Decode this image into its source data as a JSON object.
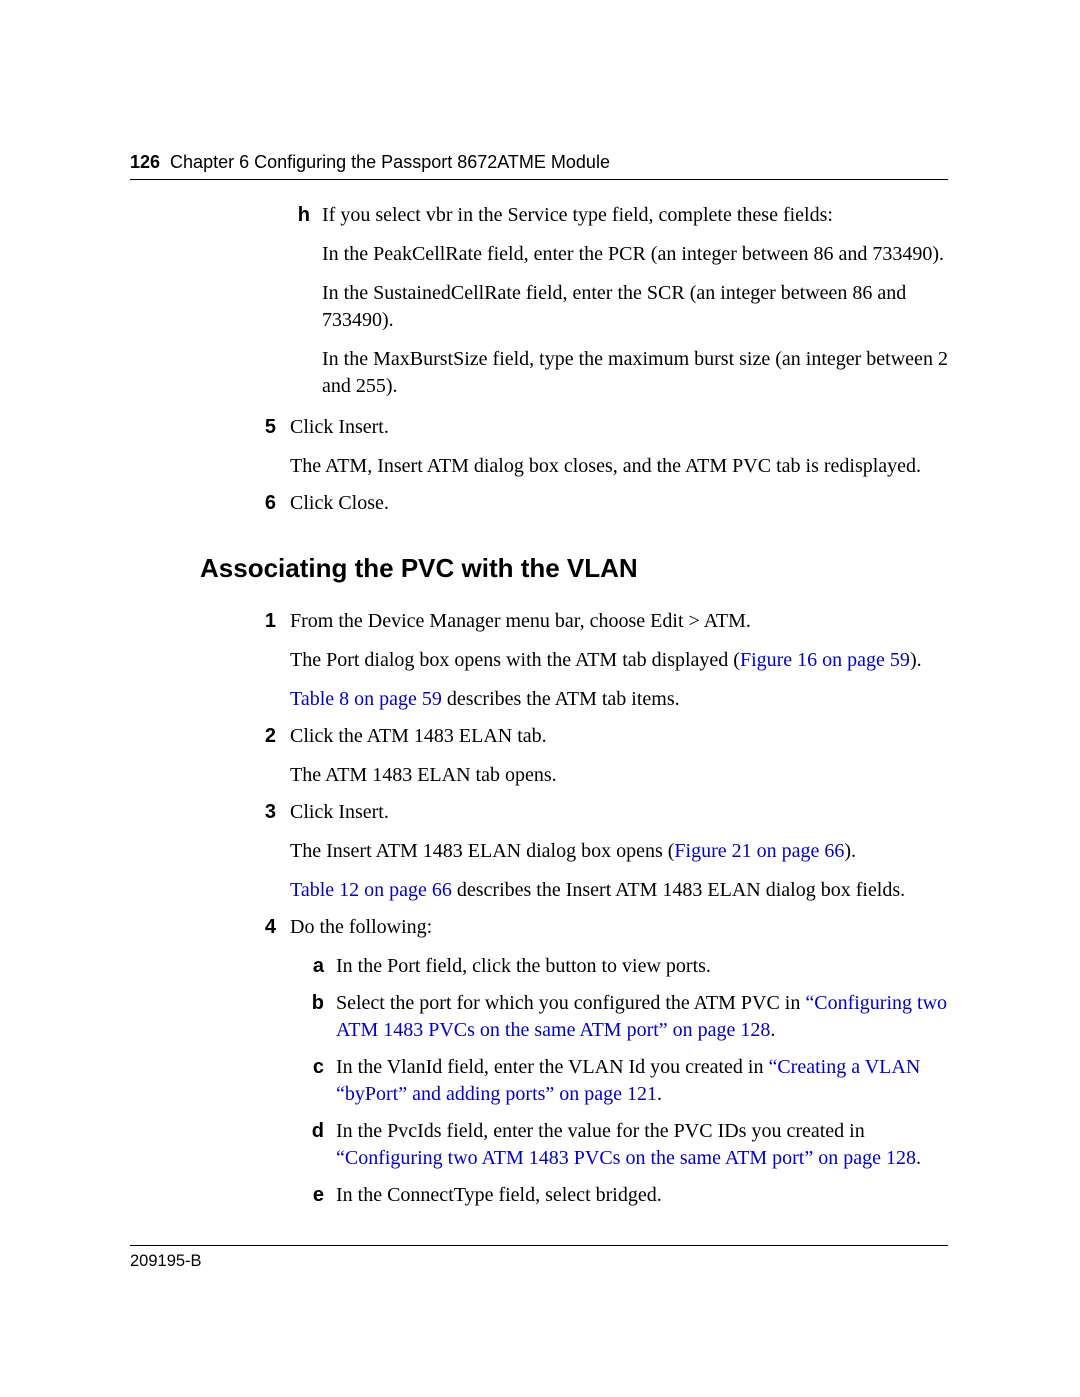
{
  "header": {
    "page_number": "126",
    "chapter_line": "Chapter 6  Configuring the Passport 8672ATME Module"
  },
  "footer": {
    "doc_id": "209195-B"
  },
  "top_sub": {
    "marker": "h",
    "line1": "If you select vbr in the Service type field, complete these fields:",
    "line2": "In the PeakCellRate field, enter the PCR (an integer between 86 and 733490).",
    "line3": "In the SustainedCellRate field, enter the SCR (an integer between 86 and 733490).",
    "line4": "In the MaxBurstSize field, type the maximum burst size (an integer between 2 and 255)."
  },
  "top_steps": {
    "step5": {
      "marker": "5",
      "line1": "Click Insert.",
      "line2": "The ATM, Insert ATM dialog box closes, and the ATM PVC tab is redisplayed."
    },
    "step6": {
      "marker": "6",
      "line1": "Click Close."
    }
  },
  "section_title": "Associating the PVC with the VLAN",
  "assoc": {
    "step1": {
      "marker": "1",
      "line1": "From the Device Manager menu bar, choose Edit > ATM.",
      "line2a": "The Port dialog box opens with the ATM tab displayed (",
      "line2_link": "Figure 16 on page 59",
      "line2b": ").",
      "line3_link": "Table 8 on page 59",
      "line3_rest": " describes the ATM tab items."
    },
    "step2": {
      "marker": "2",
      "line1": "Click the ATM 1483 ELAN tab.",
      "line2": "The ATM 1483 ELAN tab opens."
    },
    "step3": {
      "marker": "3",
      "line1": "Click Insert.",
      "line2a": "The Insert ATM 1483 ELAN dialog box opens (",
      "line2_link": "Figure 21 on page 66",
      "line2b": ").",
      "line3_link": "Table 12 on page 66",
      "line3_rest": " describes the Insert ATM 1483 ELAN dialog box fields."
    },
    "step4": {
      "marker": "4",
      "lead": "Do the following:",
      "a": {
        "marker": "a",
        "text": "In the Port field, click the button to view ports."
      },
      "b": {
        "marker": "b",
        "pre": "Select the port for which you configured the ATM PVC in ",
        "link": "“Configuring two ATM 1483 PVCs on the same ATM port” on page 128",
        "post": "."
      },
      "c": {
        "marker": "c",
        "pre": "In the VlanId field, enter the VLAN Id you created in ",
        "link": "“Creating a VLAN “byPort” and adding ports” on page 121",
        "post": "."
      },
      "d": {
        "marker": "d",
        "pre": "In the PvcIds field, enter the value for the PVC IDs you created in ",
        "link": "“Configuring two ATM 1483 PVCs on the same ATM port” on page 128",
        "post": "."
      },
      "e": {
        "marker": "e",
        "text": "In the ConnectType field, select bridged."
      }
    }
  }
}
